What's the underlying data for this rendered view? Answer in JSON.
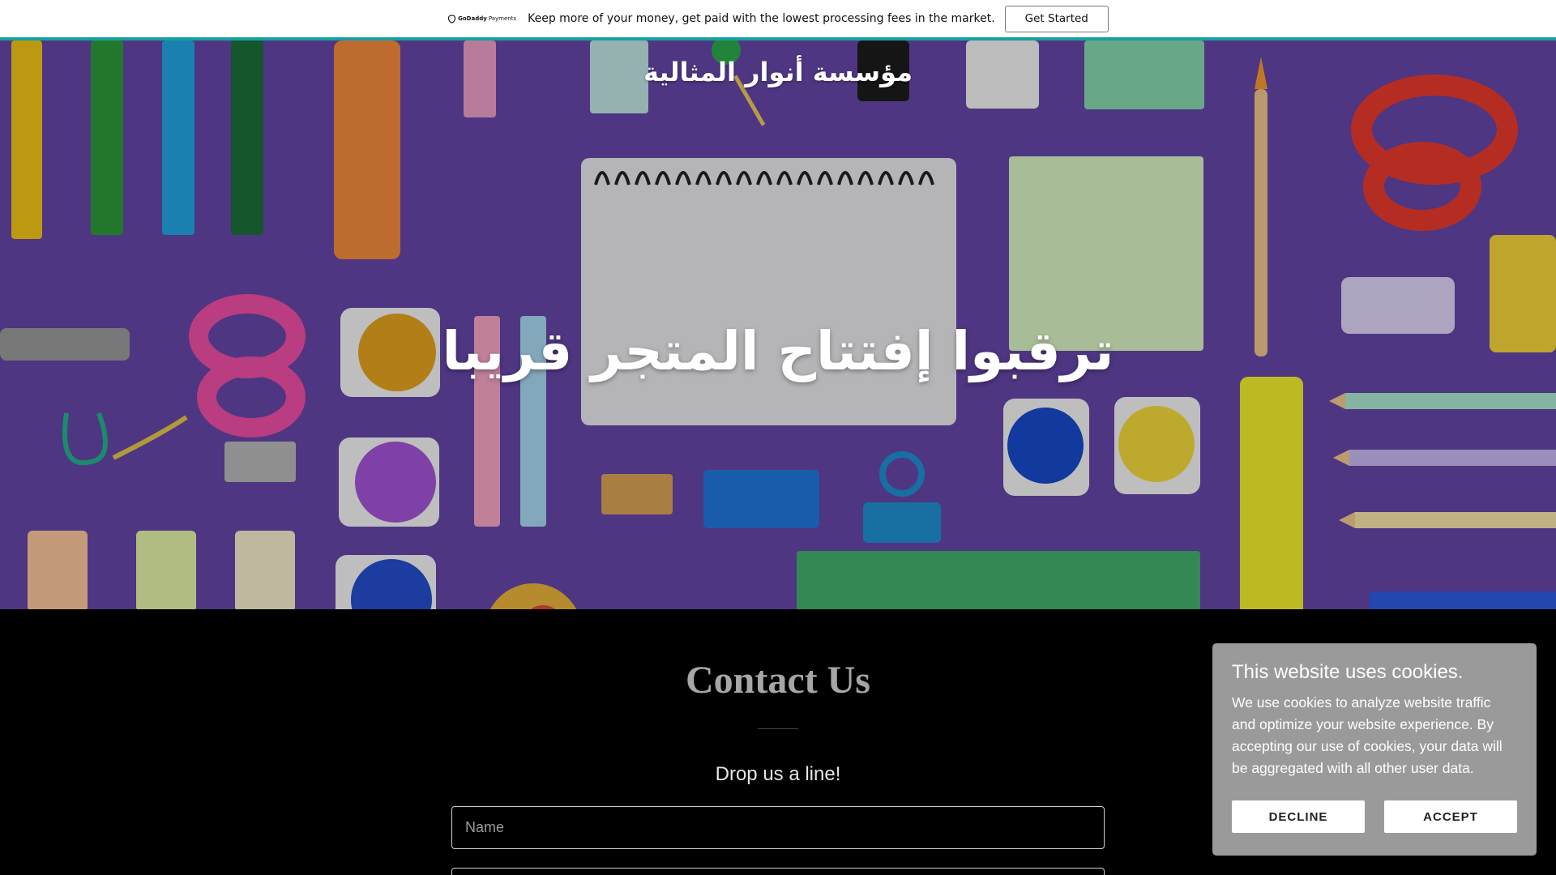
{
  "promo": {
    "logo_brand": "GoDaddy",
    "logo_product": "Payments",
    "logo_icon": "godaddy-logo-icon",
    "message": "Keep more of your money, get paid with the lowest processing fees in the market.",
    "cta_label": "Get Started"
  },
  "hero": {
    "site_title": "مؤسسة أنوار المثالية",
    "heading": "ترقبوا إفتتاح المتجر قريبا",
    "background_image": "school-stationery-flatlay-on-purple"
  },
  "contact": {
    "title": "Contact Us",
    "subtitle": "Drop us a line!",
    "name_placeholder": "Name"
  },
  "cookie_banner": {
    "title": "This website uses cookies.",
    "body": "We use cookies to analyze website traffic and optimize your website experience. By accepting our use of cookies, your data will be aggregated with all other user data.",
    "decline_label": "DECLINE",
    "accept_label": "ACCEPT"
  },
  "colors": {
    "accent_line": "#17a0a3",
    "hero_background": "#6446a7",
    "cookie_background": "#9a9a9a"
  }
}
